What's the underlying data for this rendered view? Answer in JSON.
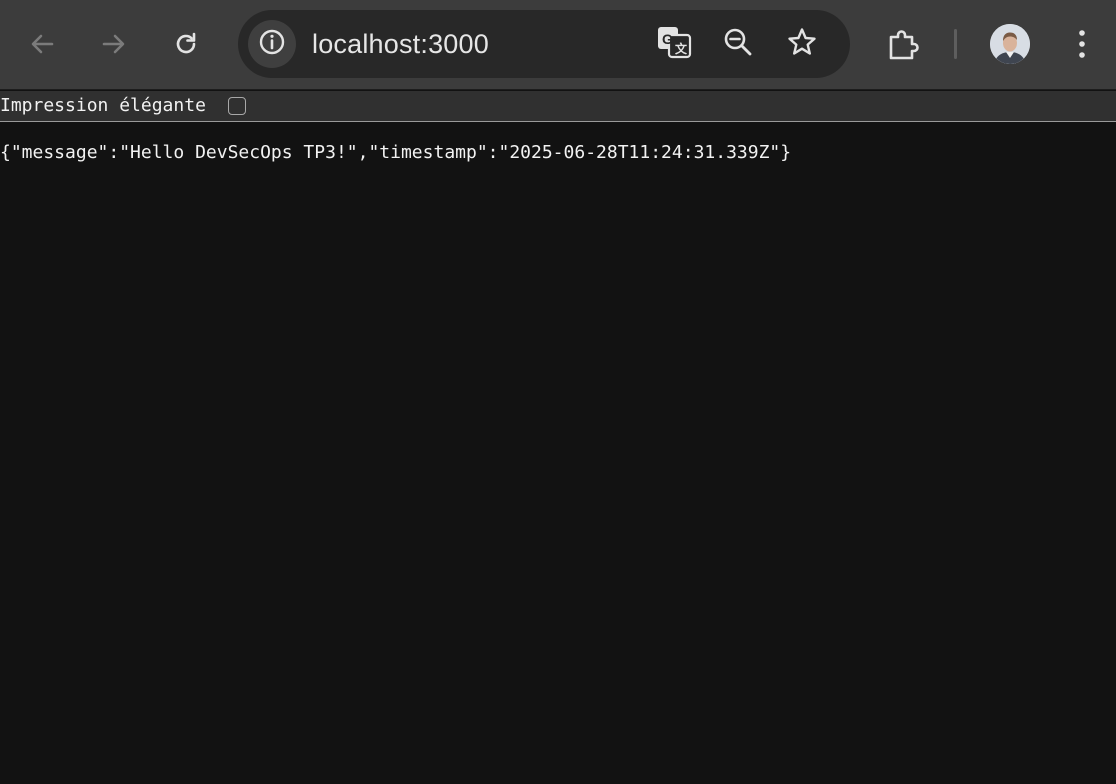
{
  "toolbar": {
    "back_icon": "arrow-left-icon",
    "forward_icon": "arrow-right-icon",
    "reload_icon": "reload-icon",
    "extensions_icon": "puzzle-icon",
    "menu_icon": "kebab-menu-icon",
    "profile_icon": "avatar"
  },
  "omnibox": {
    "site_info_icon": "info-icon",
    "url": "localhost:3000",
    "translate_icon": "translate-icon",
    "zoom_icon": "zoom-out-icon",
    "bookmark_icon": "star-icon"
  },
  "pretty_print": {
    "label": "Impression élégante",
    "checked": false
  },
  "page": {
    "raw_json": "{\"message\":\"Hello DevSecOps TP3!\",\"timestamp\":\"2025-06-28T11:24:31.339Z\"}"
  },
  "colors": {
    "toolbar_bg": "#3c3c3c",
    "omnibox_bg": "#282828",
    "page_bg": "#121212",
    "text": "#f2f2f2"
  }
}
